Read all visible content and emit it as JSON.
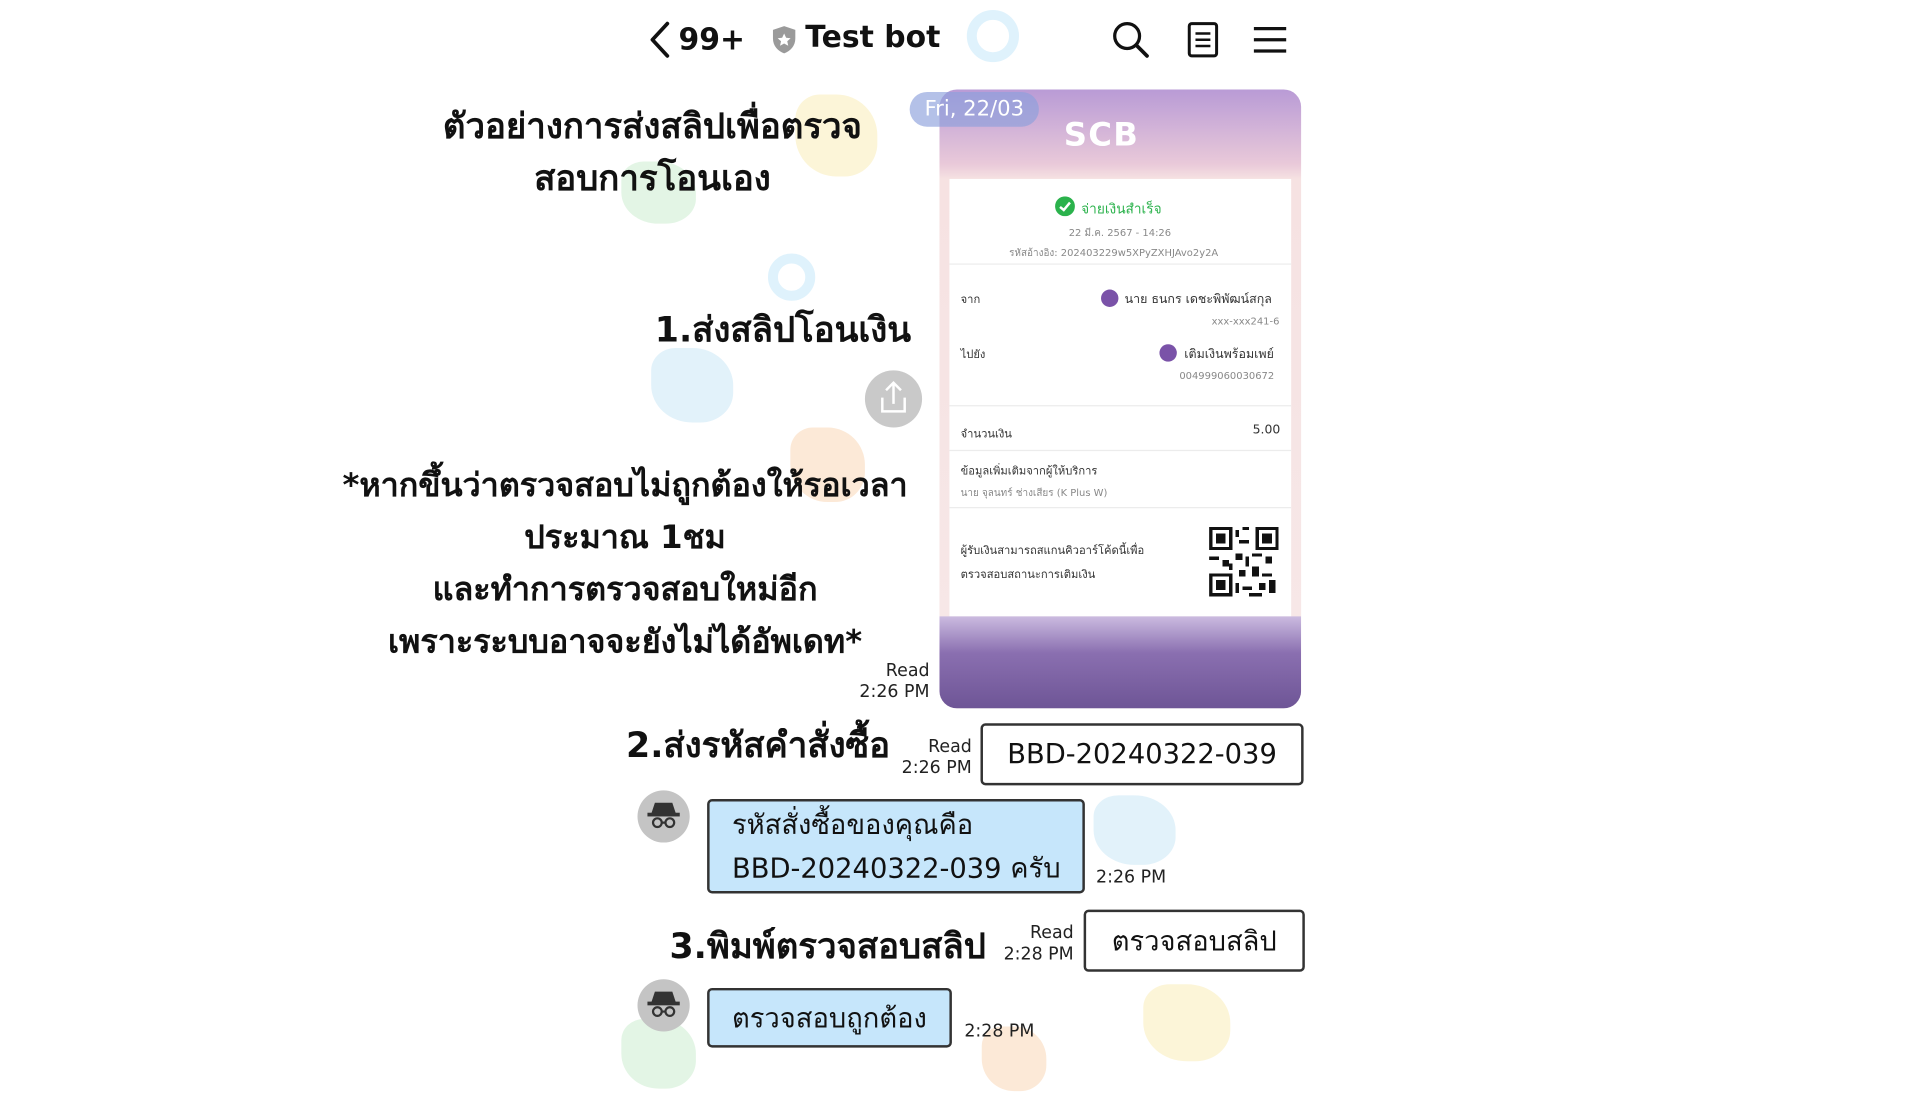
{
  "header": {
    "unread_count": "99+",
    "chat_title": "Test bot",
    "icons": [
      "back-chevron-icon",
      "shield-icon",
      "search-icon",
      "notes-icon",
      "menu-icon"
    ]
  },
  "instructions": {
    "title_line1": "ตัวอย่างการส่งสลิปเพื่อตรวจ",
    "title_line2": "สอบการโอนเอง",
    "step1": "1.ส่งสลิปโอนเงิน",
    "note_line1": "*หากขึ้นว่าตรวจสอบไม่ถูกต้องให้รอเวลา",
    "note_line2": "ประมาณ 1ชม",
    "note_line3": "และทำการตรวจสอบใหม่อีก",
    "note_line4": "เพราะระบบอาจจะยังไม่ได้อัพเดท*",
    "step2": "2.ส่งรหัสคำสั่งซื้อ",
    "step3": "3.พิมพ์ตรวจสอบสลิป"
  },
  "receipt": {
    "date_pill": "Fri, 22/03",
    "bank": "SCB",
    "status": "จ่ายเงินสำเร็จ",
    "datetime": "22 มี.ค. 2567 - 14:26",
    "ref": "รหัสอ้างอิง: 202403229w5XPyZXHJAvo2y2A",
    "from_label": "จาก",
    "from_name": "นาย ธนกร เดชะพิพัฒน์สกุล",
    "from_account": "xxx-xxx241-6",
    "to_label": "ไปยัง",
    "to_name": "เติมเงินพร้อมเพย์",
    "to_account": "004999060030672",
    "amount_label": "จำนวนเงิน",
    "amount": "5.00",
    "info_label": "ข้อมูลเพิ่มเติมจากผู้ให้บริการ",
    "info_value": "นาย จุลนทร์ ช่างเสียร (K Plus W)",
    "qr_text_line1": "ผู้รับเงินสามารถสแกนคิวอาร์โค้ดนี้เพื่อ",
    "qr_text_line2": "ตรวจสอบสถานะการเติมเงิน"
  },
  "messages": {
    "slip_read": "Read",
    "slip_time": "2:26 PM",
    "order_read": "Read",
    "order_time": "2:26 PM",
    "order_code": "BBD-20240322-039",
    "bot_reply1_line1": "รหัสสั่งซื้อของคุณคือ",
    "bot_reply1_line2": "BBD-20240322-039 ครับ",
    "bot_reply1_time": "2:26 PM",
    "check_read": "Read",
    "check_time": "2:28 PM",
    "check_text": "ตรวจสอบสลิป",
    "bot_reply2": "ตรวจสอบถูกต้อง",
    "bot_reply2_time": "2:28 PM"
  },
  "colors": {
    "bot_bubble": "#c6e6fb",
    "success_green": "#2bb24c",
    "scb_purple": "#7a52a8"
  }
}
